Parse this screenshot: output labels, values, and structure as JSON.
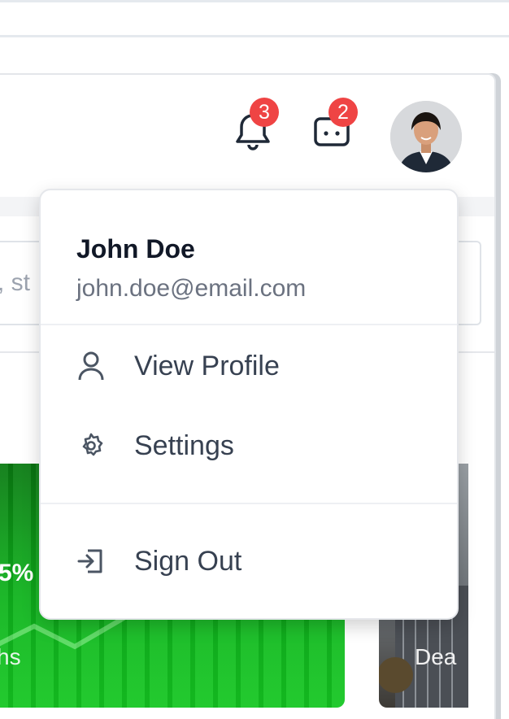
{
  "header": {
    "notifications": {
      "icon": "bell-icon",
      "count": "3"
    },
    "messages": {
      "icon": "chat-icon",
      "count": "2"
    },
    "avatar": {
      "icon": "user-avatar"
    },
    "badge_color": "#ef4444"
  },
  "search": {
    "placeholder": "s, st"
  },
  "promo": {
    "green_value": "5%",
    "green_subtitle": "hs",
    "photo_label": "Dea"
  },
  "dropdown": {
    "user_name": "John Doe",
    "user_email": "john.doe@email.com",
    "items": [
      {
        "label": "View Profile",
        "icon": "user-icon"
      },
      {
        "label": "Settings",
        "icon": "gear-icon"
      },
      {
        "label": "Sign Out",
        "icon": "sign-out-icon"
      }
    ]
  }
}
